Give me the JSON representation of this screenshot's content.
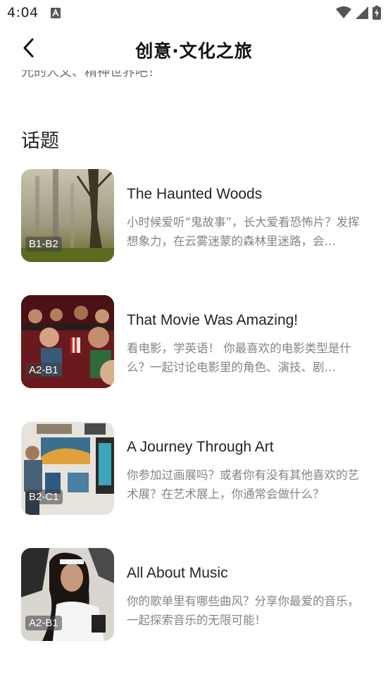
{
  "status_bar": {
    "time": "4:04",
    "icons": [
      "notification-a-icon",
      "wifi-icon",
      "cell-signal-icon",
      "battery-charging-icon"
    ]
  },
  "header": {
    "title": "创意·文化之旅",
    "back_icon": "chevron-left-icon"
  },
  "intro": {
    "text": "光的人文、精神世界吧！"
  },
  "topics_section": {
    "title": "话题",
    "items": [
      {
        "title": "The Haunted Woods",
        "level": "B1-B2",
        "description": "小时候爱听“鬼故事”，长大爱看恐怖片？发挥想象力，在云雾迷蒙的森林里迷路，会…"
      },
      {
        "title": "That Movie Was Amazing!",
        "level": "A2-B1",
        "description": "看电影，学英语！ 你最喜欢的电影类型是什么？一起讨论电影里的角色、演技、剧…"
      },
      {
        "title": "A Journey Through Art",
        "level": "B2-C1",
        "description": "你参加过画展吗？或者你有没有其他喜欢的艺术展？在艺术展上，你通常会做什么？"
      },
      {
        "title": "All About Music",
        "level": "A2-B1",
        "description": "你的歌单里有哪些曲风？分享你最爱的音乐，一起探索音乐的无限可能！"
      }
    ]
  }
}
